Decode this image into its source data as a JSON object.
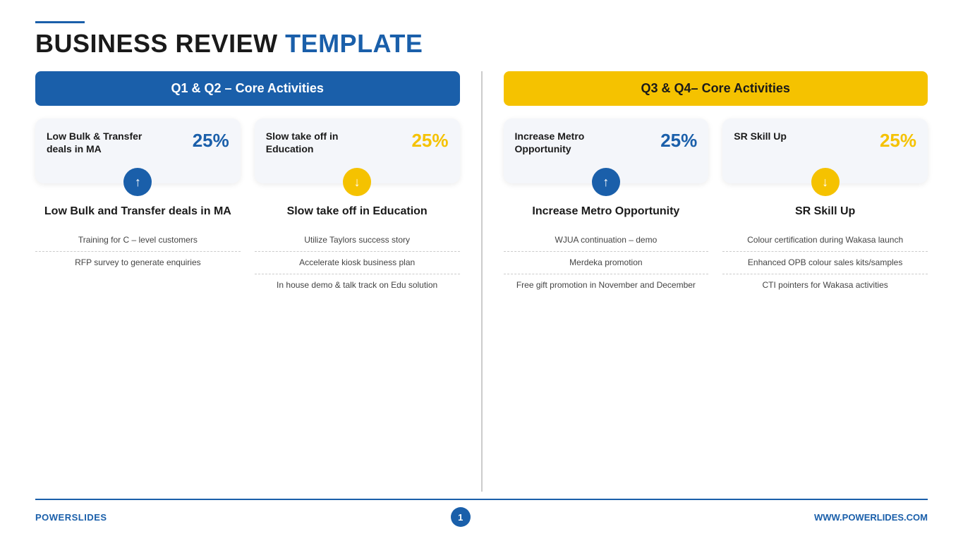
{
  "header": {
    "line_color": "#1a5faa",
    "title_black": "BUSINESS REVIEW ",
    "title_blue": "TEMPLATE"
  },
  "left_panel": {
    "header": "Q1 & Q2 – Core Activities",
    "header_style": "blue",
    "card1": {
      "label": "Low Bulk & Transfer deals in MA",
      "percent": "25%",
      "icon": "up",
      "icon_style": "blue"
    },
    "card2": {
      "label": "Slow take off in Education",
      "percent": "25%",
      "icon": "down",
      "icon_style": "yellow"
    },
    "bottom1": {
      "title": "Low Bulk and Transfer deals in MA",
      "items": [
        "Training for C – level customers",
        "RFP survey to generate enquiries"
      ]
    },
    "bottom2": {
      "title": "Slow take off in Education",
      "items": [
        "Utilize Taylors success story",
        "Accelerate kiosk business plan",
        "In house demo & talk track on Edu solution"
      ]
    }
  },
  "right_panel": {
    "header": "Q3 & Q4– Core Activities",
    "header_style": "yellow",
    "card1": {
      "label": "Increase Metro Opportunity",
      "percent": "25%",
      "icon": "up",
      "icon_style": "blue"
    },
    "card2": {
      "label": "SR Skill Up",
      "percent": "25%",
      "icon": "down",
      "icon_style": "yellow"
    },
    "bottom1": {
      "title": "Increase Metro Opportunity",
      "items": [
        "WJUA continuation – demo",
        "Merdeka promotion",
        "Free gift promotion in November and December"
      ]
    },
    "bottom2": {
      "title": "SR Skill Up",
      "items": [
        "Colour certification during Wakasa launch",
        "Enhanced OPB colour sales kits/samples",
        "CTI pointers for Wakasa activities"
      ]
    }
  },
  "footer": {
    "brand_black": "POWER",
    "brand_blue": "SLIDES",
    "page_number": "1",
    "url": "WWW.POWERLIDES.COM"
  }
}
